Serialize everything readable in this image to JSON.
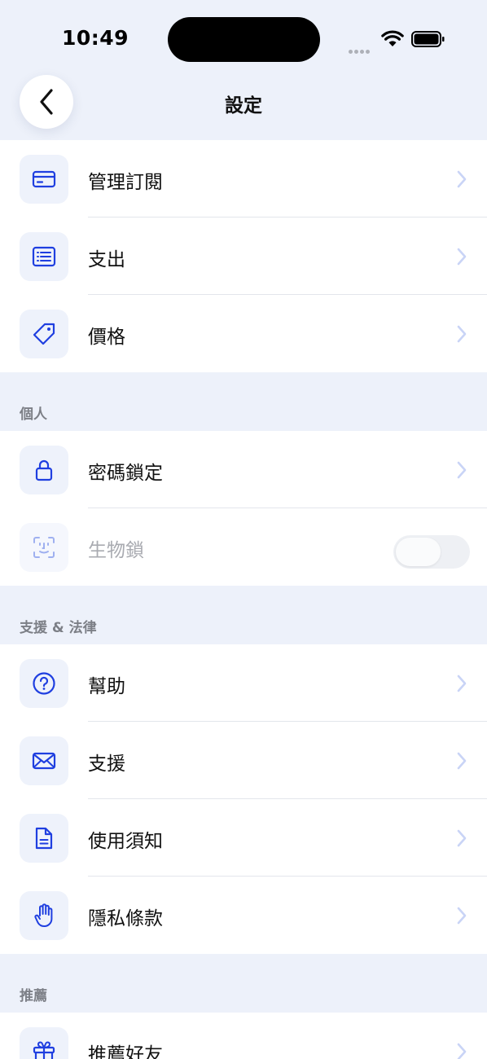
{
  "status_bar": {
    "time": "10:49"
  },
  "nav": {
    "title": "設定"
  },
  "groups": {
    "account": {
      "items": [
        {
          "label": "管理訂閱",
          "icon": "credit-card-icon"
        },
        {
          "label": "支出",
          "icon": "list-icon"
        },
        {
          "label": "價格",
          "icon": "tag-icon"
        }
      ]
    },
    "personal": {
      "header": "個人",
      "items": [
        {
          "label": "密碼鎖定",
          "icon": "lock-icon"
        },
        {
          "label": "生物鎖",
          "icon": "face-id-icon",
          "toggle": "off",
          "disabled": true
        }
      ]
    },
    "support": {
      "header": "支援 & 法律",
      "items": [
        {
          "label": "幫助",
          "icon": "question-icon"
        },
        {
          "label": "支援",
          "icon": "mail-icon"
        },
        {
          "label": "使用須知",
          "icon": "document-icon"
        },
        {
          "label": "隱私條款",
          "icon": "hand-icon"
        }
      ]
    },
    "referral": {
      "header": "推薦",
      "items": [
        {
          "label": "推薦好友",
          "icon": "gift-icon"
        }
      ]
    }
  },
  "colors": {
    "accent": "#1f3fe0",
    "background": "#edf1fa",
    "chevron": "#c9d4f6",
    "icon_tile": "#eef2fb"
  }
}
